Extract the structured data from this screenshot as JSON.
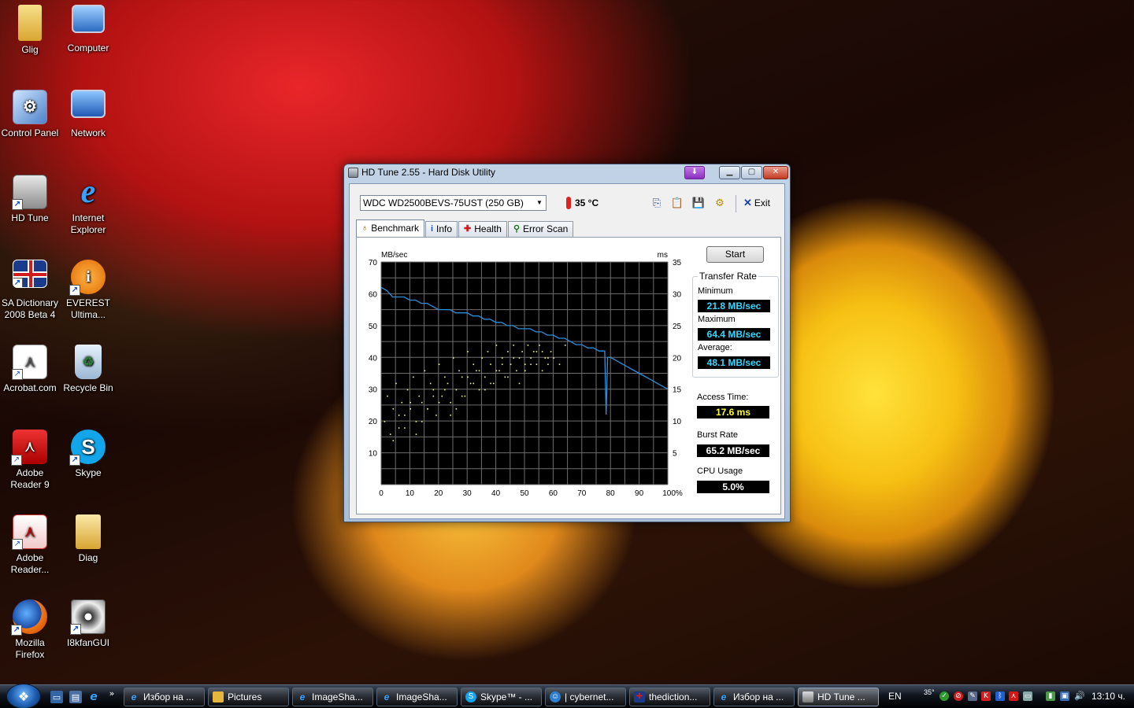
{
  "desktop": {
    "icons": [
      {
        "label": "Glig"
      },
      {
        "label": "Computer"
      },
      {
        "label": "Control Panel"
      },
      {
        "label": "Network"
      },
      {
        "label": "HD Tune"
      },
      {
        "label": "Internet Explorer"
      },
      {
        "label": "SA Dictionary 2008 Beta 4"
      },
      {
        "label": "EVEREST Ultima..."
      },
      {
        "label": "Acrobat.com"
      },
      {
        "label": "Recycle Bin"
      },
      {
        "label": "Adobe Reader 9"
      },
      {
        "label": "Skype"
      },
      {
        "label": "Adobe Reader..."
      },
      {
        "label": "Diag"
      },
      {
        "label": "Mozilla Firefox"
      },
      {
        "label": "I8kfanGUI"
      }
    ]
  },
  "window": {
    "title": "HD Tune 2.55 - Hard Disk Utility",
    "drive": "WDC WD2500BEVS-75UST (250 GB)",
    "temperature": "35 °C",
    "exit_label": "Exit",
    "tabs": [
      {
        "label": "Benchmark",
        "icon": "gauge-icon",
        "active": true
      },
      {
        "label": "Info",
        "icon": "info-icon"
      },
      {
        "label": "Health",
        "icon": "health-cross-icon"
      },
      {
        "label": "Error Scan",
        "icon": "magnifier-icon"
      }
    ],
    "start_label": "Start",
    "stats": {
      "transfer_rate_label": "Transfer Rate",
      "minimum_label": "Minimum",
      "minimum": "21.8 MB/sec",
      "maximum_label": "Maximum",
      "maximum": "64.4 MB/sec",
      "average_label": "Average:",
      "average": "48.1 MB/sec",
      "access_time_label": "Access Time:",
      "access_time": "17.6 ms",
      "burst_rate_label": "Burst Rate",
      "burst_rate": "65.2 MB/sec",
      "cpu_usage_label": "CPU Usage",
      "cpu_usage": "5.0%"
    },
    "colors": {
      "rate_value": "#36d7ff",
      "access_value": "#ffff33",
      "white_value": "#ffffff",
      "transfer_line": "#2d8fd8",
      "access_dots": "#f2f28a"
    }
  },
  "chart_data": {
    "type": "line",
    "ylabel_left": "MB/sec",
    "ylabel_right": "ms",
    "x_ticks": [
      "0",
      "10",
      "20",
      "30",
      "40",
      "50",
      "60",
      "70",
      "80",
      "90",
      "100%"
    ],
    "y_left_ticks": [
      "10",
      "20",
      "30",
      "40",
      "50",
      "60",
      "70"
    ],
    "y_right_ticks": [
      "5",
      "10",
      "15",
      "20",
      "25",
      "30",
      "35"
    ],
    "xlim": [
      0,
      100
    ],
    "ylim_left": [
      0,
      70
    ],
    "ylim_right": [
      0,
      35
    ],
    "grid": true,
    "series": [
      {
        "kind": "line",
        "x": [
          0,
          2,
          4,
          6,
          8,
          10,
          12,
          14,
          16,
          18,
          20,
          22,
          24,
          26,
          28,
          30,
          32,
          34,
          36,
          38,
          40,
          42,
          44,
          46,
          48,
          50,
          52,
          54,
          56,
          58,
          60,
          62,
          64,
          66,
          68,
          70,
          72,
          74,
          76,
          78,
          78.5,
          79,
          80,
          82,
          84,
          86,
          88,
          90,
          92,
          94,
          96,
          98,
          100
        ],
        "values": [
          62,
          61,
          59,
          59,
          59,
          58,
          58,
          57,
          57,
          56,
          55,
          55,
          55,
          54,
          54,
          54,
          53,
          53,
          52,
          52,
          51,
          51,
          50,
          50,
          49,
          49,
          49,
          48,
          48,
          47,
          47,
          46,
          46,
          45,
          44,
          44,
          43,
          43,
          42,
          42,
          22,
          40,
          40,
          39,
          38,
          37,
          36,
          35,
          34,
          33,
          32,
          31,
          30
        ]
      },
      {
        "kind": "scatter",
        "x": [
          1,
          2,
          3,
          4,
          5,
          6,
          7,
          8,
          9,
          10,
          11,
          12,
          13,
          14,
          15,
          16,
          17,
          18,
          19,
          20,
          21,
          22,
          23,
          24,
          25,
          26,
          27,
          28,
          29,
          30,
          31,
          32,
          33,
          34,
          35,
          36,
          37,
          38,
          39,
          40,
          41,
          42,
          43,
          44,
          45,
          46,
          47,
          48,
          49,
          50,
          51,
          52,
          53,
          54,
          55,
          56,
          57,
          58,
          59,
          60,
          4,
          8,
          12,
          16,
          20,
          24,
          28,
          32,
          36,
          40,
          44,
          48,
          52,
          56,
          6,
          10,
          14,
          18,
          22,
          26,
          30,
          34,
          38,
          42,
          46,
          50,
          54,
          58,
          62,
          64
        ],
        "values": [
          10,
          14,
          8,
          12,
          16,
          9,
          13,
          11,
          15,
          12,
          17,
          10,
          14,
          13,
          18,
          12,
          16,
          15,
          11,
          19,
          14,
          17,
          16,
          13,
          20,
          15,
          18,
          17,
          14,
          21,
          16,
          19,
          18,
          15,
          20,
          17,
          21,
          19,
          16,
          22,
          18,
          20,
          17,
          21,
          19,
          22,
          18,
          20,
          21,
          19,
          22,
          20,
          21,
          19,
          22,
          21,
          20,
          19,
          21,
          20,
          7,
          9,
          8,
          12,
          13,
          11,
          14,
          16,
          15,
          18,
          17,
          16,
          19,
          18,
          11,
          13,
          10,
          14,
          15,
          12,
          17,
          18,
          16,
          19,
          20,
          18,
          21,
          20,
          19,
          22
        ]
      }
    ]
  },
  "taskbar": {
    "quick_launch": [
      "show-desktop-icon",
      "switch-windows-icon",
      "ie-icon"
    ],
    "overflow": "»",
    "buttons": [
      {
        "label": "Избор на ...",
        "icon": "ie-icon"
      },
      {
        "label": "Pictures",
        "icon": "folder-icon"
      },
      {
        "label": "ImageSha...",
        "icon": "ie-icon"
      },
      {
        "label": "ImageSha...",
        "icon": "ie-icon"
      },
      {
        "label": "Skype™ - ...",
        "icon": "skype-icon"
      },
      {
        "label": "| cybernet...",
        "icon": "messenger-icon"
      },
      {
        "label": "thediction...",
        "icon": "uk-flag-icon"
      },
      {
        "label": "Избор на ...",
        "icon": "ie-icon"
      },
      {
        "label": "HD Tune ...",
        "icon": "hdtune-icon",
        "active": true
      }
    ],
    "language": "EN",
    "tray_temp": "35°",
    "clock": "13:10 ч."
  }
}
